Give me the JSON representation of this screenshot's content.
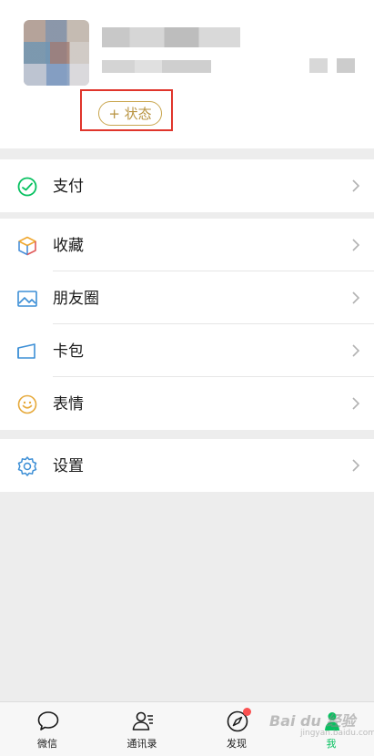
{
  "profile": {
    "status_button_label": "+ 状态"
  },
  "menu": {
    "pay": {
      "label": "支付",
      "icon": "pay-icon"
    },
    "favorites": {
      "label": "收藏",
      "icon": "favorites-cube-icon"
    },
    "moments": {
      "label": "朋友圈",
      "icon": "moments-image-icon"
    },
    "cards": {
      "label": "卡包",
      "icon": "card-wallet-icon"
    },
    "stickers": {
      "label": "表情",
      "icon": "smiley-icon"
    },
    "settings": {
      "label": "设置",
      "icon": "gear-icon"
    }
  },
  "tabbar": {
    "tabs": [
      {
        "label": "微信",
        "icon": "chat-bubble-icon",
        "active": false
      },
      {
        "label": "通讯录",
        "icon": "contacts-icon",
        "active": false
      },
      {
        "label": "发现",
        "icon": "compass-icon",
        "active": false,
        "badge_dot": true
      },
      {
        "label": "我",
        "icon": "person-icon",
        "active": true
      }
    ]
  },
  "watermark": {
    "text": "Bai du 经验",
    "sub": "jingyan.baidu.com"
  },
  "colors": {
    "accent_green": "#07c160",
    "status_gold": "#c9a64f",
    "highlight_red": "#e0352b",
    "badge_red": "#fa5151"
  }
}
